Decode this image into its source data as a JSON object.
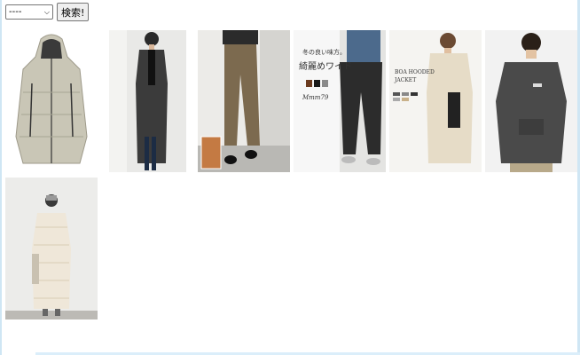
{
  "search": {
    "select_value": "----",
    "button_label": "検索!"
  },
  "products": [
    {
      "name": "hooded-down-jacket"
    },
    {
      "name": "long-coat-man"
    },
    {
      "name": "chino-pants"
    },
    {
      "name": "wide-pants-promo",
      "overlay_line1": "冬の良い味方。",
      "overlay_line2": "綺麗めワイド",
      "overlay_brand": "Mmm79"
    },
    {
      "name": "boa-hooded-jacket",
      "overlay_line1": "BOA HOODED",
      "overlay_line2": "JACKET"
    },
    {
      "name": "gray-hoodie"
    },
    {
      "name": "quilted-long-coat"
    }
  ],
  "colors": {
    "frame": "#cfe6f4",
    "button_bg": "#efefef"
  }
}
